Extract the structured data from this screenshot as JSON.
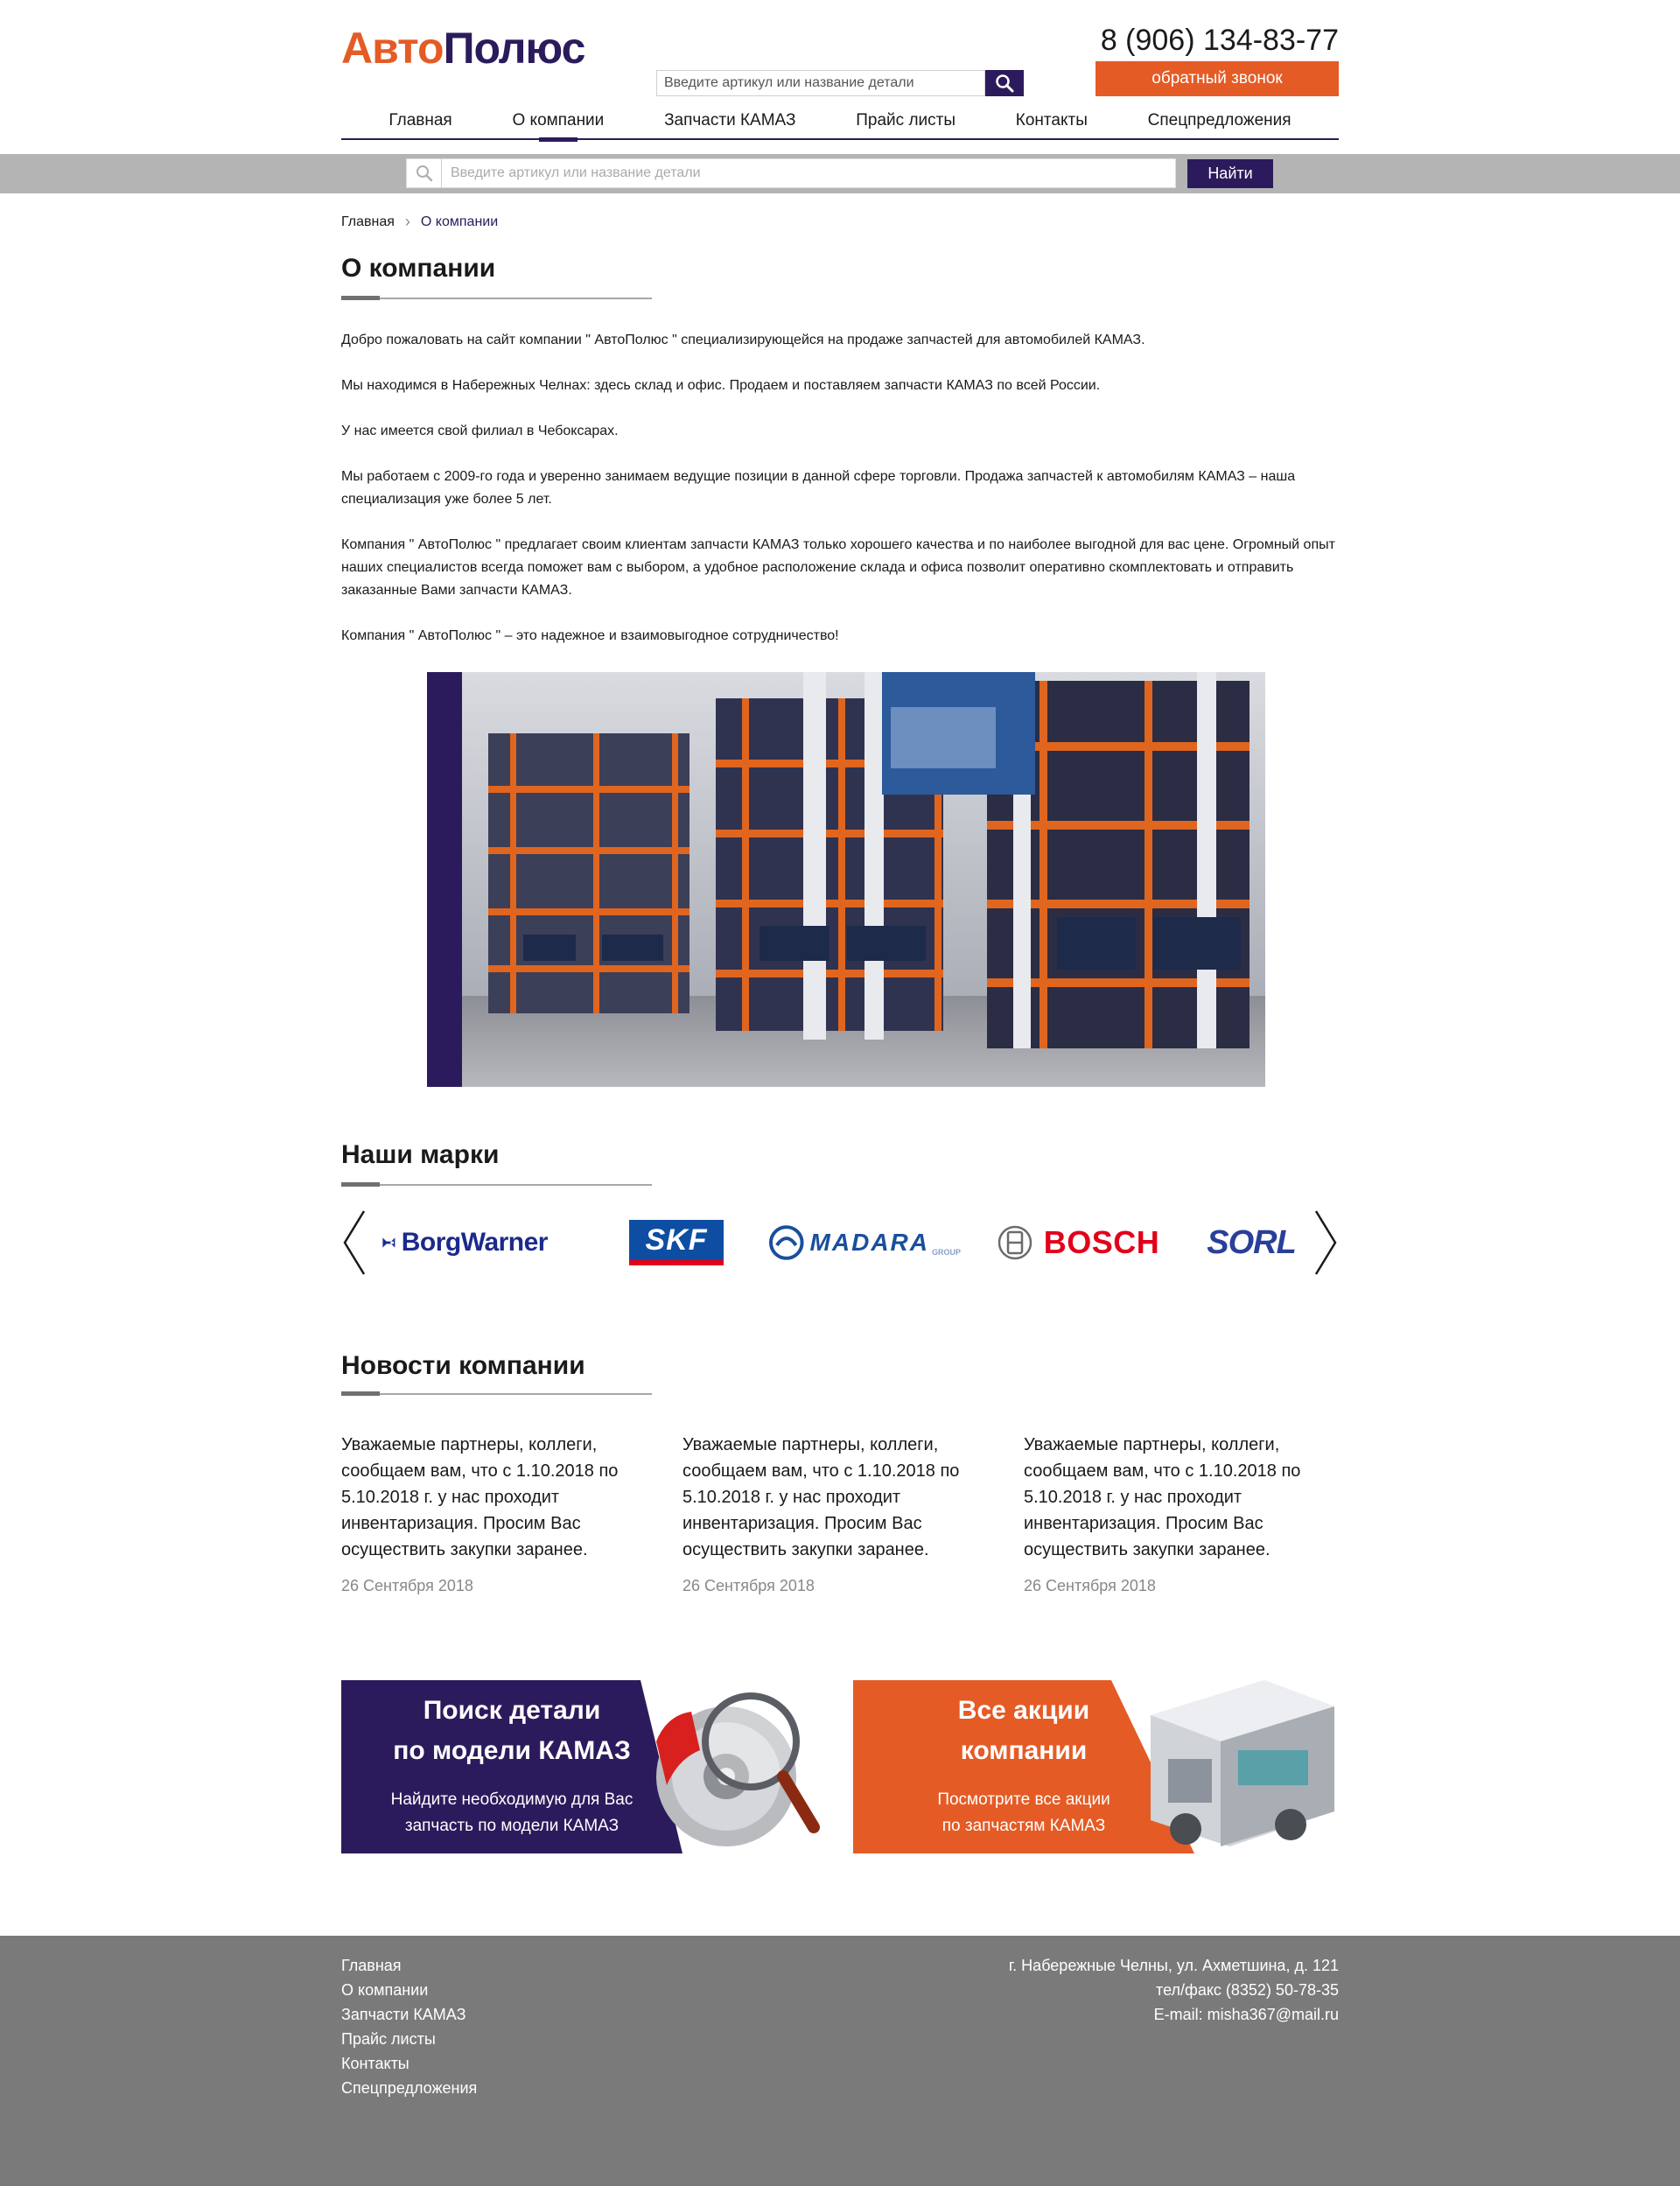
{
  "header": {
    "logo_part1": "Авто",
    "logo_part2": "Полюс",
    "search_placeholder": "Введите артикул или название детали",
    "phone": "8 (906) 134-83-77",
    "callback_label": "обратный звонок"
  },
  "nav": {
    "items": [
      {
        "label": "Главная"
      },
      {
        "label": "О компании",
        "active": true
      },
      {
        "label": "Запчасти КАМАЗ"
      },
      {
        "label": "Прайс листы"
      },
      {
        "label": "Контакты"
      },
      {
        "label": "Спецпредложения"
      }
    ]
  },
  "search": {
    "placeholder": "Введите артикул или название детали",
    "button_label": "Найти"
  },
  "breadcrumb": {
    "home": "Главная",
    "current": "О компании"
  },
  "about": {
    "title": "О компании",
    "paragraphs": [
      "Добро пожаловать на сайт компании \" АвтоПолюс \" специализирующейся на продаже запчастей  для автомобилей КАМАЗ.",
      "Мы находимся в Набережных Челнах: здесь склад и офис. Продаем и поставляем запчасти КАМАЗ по всей России.",
      " У нас имеется свой филиал в Чебоксарах.",
      " Мы работаем с 2009-го года и уверенно занимаем ведущие позиции в данной сфере торговли. Продажа запчастей к автомобилям КАМАЗ  – наша специализация уже более 5 лет.",
      " Компания \" АвтоПолюс \" предлагает своим клиентам запчасти  КАМАЗ только хорошего качества и по наиболее выгодной для вас цене. Огромный опыт наших специалистов всегда поможет вам с выбором, а удобное расположение склада и офиса позволит оперативно скомплектовать и отправить заказанные Вами запчасти КАМАЗ.",
      " Компания \" АвтоПолюс \" – это надежное и взаимовыгодное сотрудничество!"
    ]
  },
  "brands": {
    "title": "Наши марки",
    "items": [
      {
        "name": "BorgWarner",
        "color": "#1b2a8c"
      },
      {
        "name": "SKF",
        "color": "#0d4ea3"
      },
      {
        "name": "MADARA",
        "color": "#1a4f9c"
      },
      {
        "name": "BOSCH",
        "color": "#e2001a"
      },
      {
        "name": "SORL",
        "color": "#2a3f9a"
      }
    ],
    "madara_suffix": "GROUP"
  },
  "news": {
    "title": "Новости компании",
    "items": [
      {
        "text": "Уважаемые партнеры, коллеги, сообщаем вам, что с 1.10.2018 по 5.10.2018 г. у нас проходит инвентаризация. Просим Вас осуществить закупки заранее.",
        "date": "26 Сентября 2018"
      },
      {
        "text": "Уважаемые партнеры, коллеги, сообщаем вам, что с 1.10.2018 по 5.10.2018 г. у нас проходит инвентаризация. Просим Вас осуществить закупки заранее.",
        "date": "26 Сентября 2018"
      },
      {
        "text": "Уважаемые партнеры, коллеги, сообщаем вам, что с 1.10.2018 по 5.10.2018 г. у нас проходит инвентаризация. Просим Вас осуществить закупки заранее.",
        "date": "26 Сентября 2018"
      }
    ]
  },
  "banners": {
    "search": {
      "title_line1": "Поиск детали",
      "title_line2": "по модели КАМАЗ",
      "sub_line1": "Найдите необходимую для Вас",
      "sub_line2": "запчасть по модели КАМАЗ",
      "color": "#2c1b5c"
    },
    "promo": {
      "title_line1": "Все акции",
      "title_line2": "компании",
      "sub_line1": "Посмотрите все акции",
      "sub_line2": "по запчастям КАМАЗ",
      "color": "#e55b25"
    }
  },
  "footer": {
    "links": [
      "Главная",
      "О компании",
      "Запчасти КАМАЗ",
      "Прайс листы",
      "Контакты",
      "Спецпредложения"
    ],
    "address": "г. Набережные Челны, ул. Ахметшина, д. 121",
    "phone": "тел/факс (8352) 50-78-35",
    "email": "E-mail: misha367@mail.ru"
  },
  "colors": {
    "brand_orange": "#e55b25",
    "brand_purple": "#2c1b5c",
    "searchbar_gray": "#b4b4b4",
    "footer_gray": "#7a7a7a"
  }
}
